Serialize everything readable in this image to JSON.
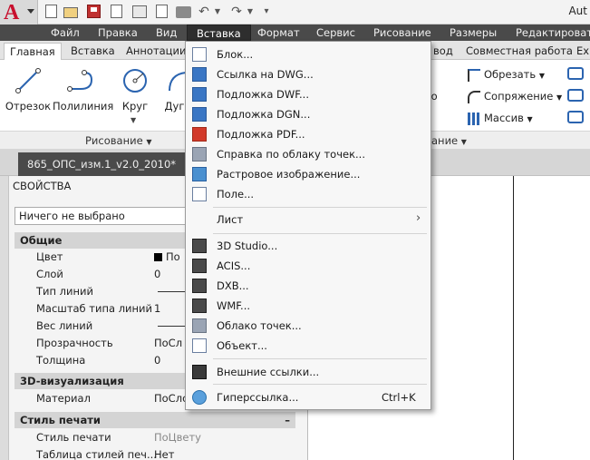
{
  "app": {
    "title_text": "Aut",
    "logo_letter": "A"
  },
  "quick_access": [
    "new-icon",
    "open-icon",
    "save-icon",
    "web-mobile-icon",
    "export-icon",
    "print-icon",
    "undo-icon",
    "redo-icon"
  ],
  "menubar": {
    "items": [
      "Файл",
      "Правка",
      "Вид",
      "Вставка",
      "Формат",
      "Сервис",
      "Рисование",
      "Размеры",
      "Редактировать"
    ]
  },
  "ribbon": {
    "tabs": [
      "Главная",
      "Вставка",
      "Аннотации",
      "вод",
      "Совместная работа",
      "Ex"
    ],
    "draw_tools": [
      {
        "label": "Отрезок",
        "icon": "line-icon"
      },
      {
        "label": "Полилиния",
        "icon": "polyline-icon"
      },
      {
        "label": "Круг",
        "icon": "circle-icon"
      },
      {
        "label": "Дуга",
        "icon": "arc-icon"
      }
    ],
    "modify_tools": [
      {
        "label": "Обрезать",
        "icon": "trim-icon"
      },
      {
        "label": "Сопряжение",
        "icon": "fillet-icon"
      },
      {
        "label": "Массив",
        "icon": "array-icon"
      }
    ],
    "partial_label": "льно",
    "panel_draw_title": "Рисование",
    "panel_modify_title": "ание"
  },
  "document_tab": {
    "name": "865_ОПС_изм.1_v2.0_2010*",
    "close": "✕"
  },
  "properties": {
    "title": "СВОЙСТВА",
    "selection": "Ничего не выбрано",
    "sections": [
      {
        "name": "Общие",
        "rows": [
          {
            "name": "Цвет",
            "value": "По"
          },
          {
            "name": "Слой",
            "value": "0"
          },
          {
            "name": "Тип линий",
            "value": ""
          },
          {
            "name": "Масштаб типа линий",
            "value": "1"
          },
          {
            "name": "Вес линий",
            "value": ""
          },
          {
            "name": "Прозрачность",
            "value": "ПоСл"
          },
          {
            "name": "Толщина",
            "value": "0"
          }
        ]
      },
      {
        "name": "3D-визуализация",
        "rows": [
          {
            "name": "Материал",
            "value": "ПоСло"
          }
        ]
      },
      {
        "name": "Стиль печати",
        "collapse": "–",
        "rows": [
          {
            "name": "Стиль печати",
            "value": "ПоЦвету"
          },
          {
            "name": "Таблица стилей печ...",
            "value": "Нет"
          }
        ]
      }
    ]
  },
  "dropdown": {
    "items": [
      {
        "label": "Блок...",
        "icon": "block-icon"
      },
      {
        "label": "Ссылка на DWG...",
        "icon": "dwg-reference-icon"
      },
      {
        "label": "Подложка DWF...",
        "icon": "dwf-underlay-icon"
      },
      {
        "label": "Подложка DGN...",
        "icon": "dgn-underlay-icon"
      },
      {
        "label": "Подложка PDF...",
        "icon": "pdf-underlay-icon"
      },
      {
        "label": "Справка по облаку точек...",
        "icon": "point-cloud-reference-icon"
      },
      {
        "label": "Растровое изображение...",
        "icon": "raster-image-icon"
      },
      {
        "label": "Поле...",
        "icon": "field-icon"
      },
      {
        "label": "Лист",
        "icon": "",
        "submenu": "›"
      },
      {
        "label": "3D Studio...",
        "icon": "3ds-icon"
      },
      {
        "label": "ACIS...",
        "icon": "acis-icon"
      },
      {
        "label": "DXB...",
        "icon": "dxb-icon"
      },
      {
        "label": "WMF...",
        "icon": "wmf-icon"
      },
      {
        "label": "Облако точек...",
        "icon": "point-cloud-icon"
      },
      {
        "label": "Объект...",
        "icon": "ole-object-icon"
      },
      {
        "label": "Внешние ссылки...",
        "icon": "external-references-icon"
      },
      {
        "label": "Гиперссылка...",
        "icon": "hyperlink-icon",
        "shortcut": "Ctrl+K"
      }
    ]
  }
}
